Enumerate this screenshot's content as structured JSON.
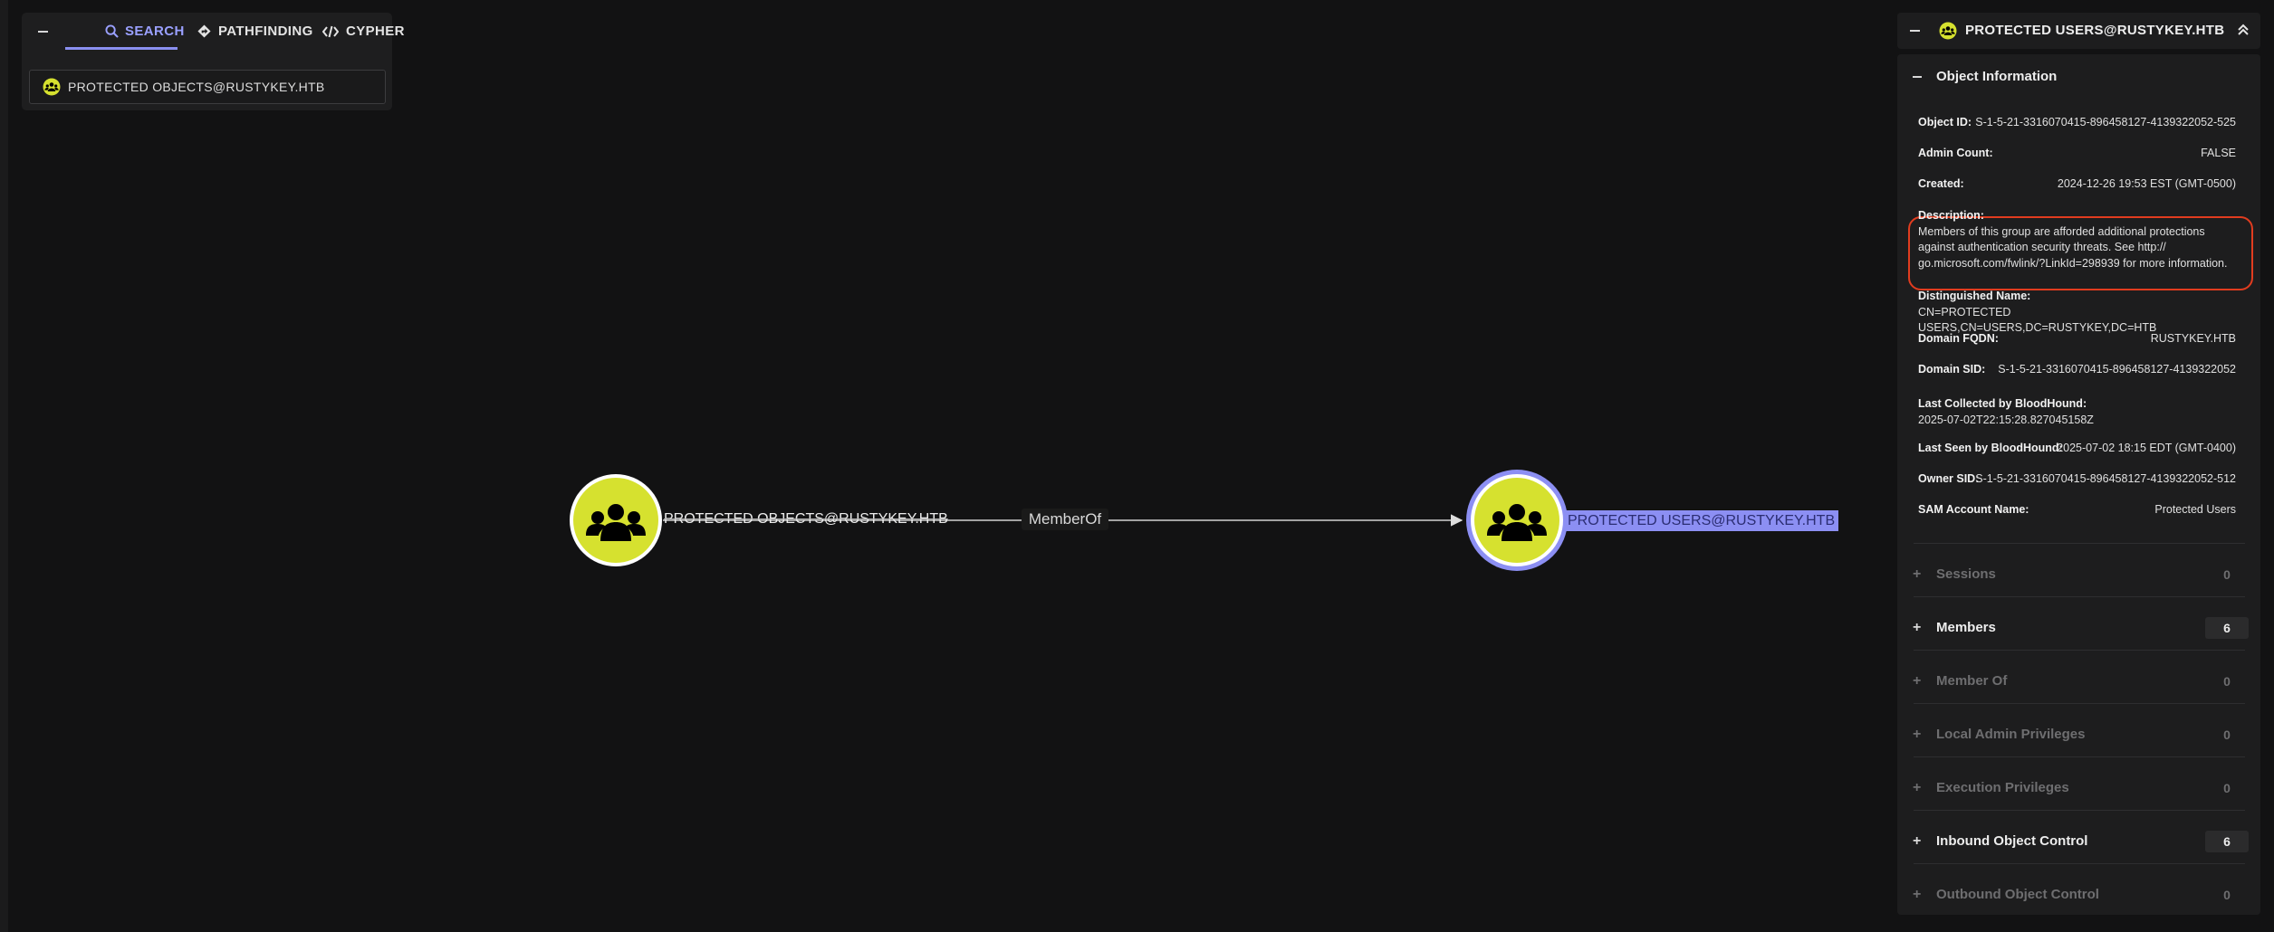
{
  "search_panel": {
    "tabs": [
      {
        "label": "SEARCH",
        "icon": "search-icon"
      },
      {
        "label": "PATHFINDING",
        "icon": "diamond-route-icon"
      },
      {
        "label": "CYPHER",
        "icon": "code-icon"
      }
    ],
    "active_tab": "SEARCH",
    "input_value": "PROTECTED OBJECTS@RUSTYKEY.HTB",
    "input_icon": "group-icon"
  },
  "graph": {
    "nodes": [
      {
        "label": "PROTECTED OBJECTS@RUSTYKEY.HTB",
        "icon": "group-icon",
        "selected": false
      },
      {
        "label": "PROTECTED USERS@RUSTYKEY.HTB",
        "icon": "group-icon",
        "selected": true
      }
    ],
    "edge_label": "MemberOf"
  },
  "entity_panel": {
    "title": "PROTECTED USERS@RUSTYKEY.HTB",
    "object_info": {
      "heading": "Object Information",
      "fields": [
        {
          "key": "Object ID:",
          "value": "S-1-5-21-3316070415-896458127-4139322052-525"
        },
        {
          "key": "Admin Count:",
          "value": "FALSE"
        },
        {
          "key": "Created:",
          "value": "2024-12-26 19:53 EST (GMT-0500)"
        },
        {
          "key": "Description:",
          "value": "Members of this group are afforded additional protections against authentication security threats. See http:// go.microsoft.com/fwlink/?LinkId=298939 for more information."
        },
        {
          "key": "Distinguished Name:",
          "value": "CN=PROTECTED USERS,CN=USERS,DC=RUSTYKEY,DC=HTB"
        },
        {
          "key": "Domain FQDN:",
          "value": "RUSTYKEY.HTB"
        },
        {
          "key": "Domain SID:",
          "value": "S-1-5-21-3316070415-896458127-4139322052"
        },
        {
          "key": "Last Collected by BloodHound:",
          "value": "2025-07-02T22:15:28.827045158Z"
        },
        {
          "key": "Last Seen by BloodHound:",
          "value": "2025-07-02 18:15 EDT (GMT-0400)"
        },
        {
          "key": "Owner SID:",
          "value": "S-1-5-21-3316070415-896458127-4139322052-512"
        },
        {
          "key": "SAM Account Name:",
          "value": "Protected Users"
        }
      ]
    },
    "sections": [
      {
        "label": "Sessions",
        "count": "0"
      },
      {
        "label": "Members",
        "count": "6"
      },
      {
        "label": "Member Of",
        "count": "0"
      },
      {
        "label": "Local Admin Privileges",
        "count": "0"
      },
      {
        "label": "Execution Privileges",
        "count": "0"
      },
      {
        "label": "Inbound Object Control",
        "count": "6"
      },
      {
        "label": "Outbound Object Control",
        "count": "0"
      }
    ]
  },
  "colors": {
    "node_fill": "#d6e12f",
    "selected_ring": "#8c8ff3",
    "highlight": "#e13c1f",
    "accent": "#9aa0ff"
  }
}
